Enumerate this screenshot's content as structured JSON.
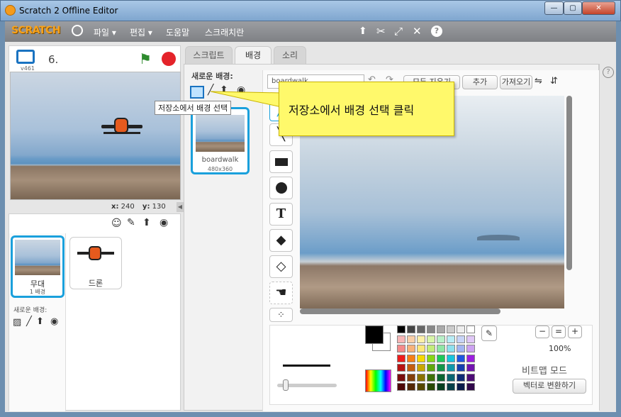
{
  "window": {
    "title": "Scratch 2 Offline Editor",
    "min": "—",
    "max": "▢",
    "close": "✕"
  },
  "menu": {
    "logo": "SCRATCH",
    "file": "파일 ▾",
    "edit": "편집 ▾",
    "help": "도움말",
    "tutorial": "스크래치란"
  },
  "stage": {
    "version": "v461",
    "number": "6.",
    "x_label": "x:",
    "x_value": "240",
    "y_label": "y:",
    "y_value": "130"
  },
  "tabs": [
    "스크립트",
    "배경",
    "소리"
  ],
  "new_backdrop_label": "새로운 배경:",
  "tooltip": "저장소에서 배경 선택",
  "callout": "저장소에서 배경 선택 클릭",
  "backdrop": {
    "name": "boardwalk",
    "size": "480x360",
    "name_field": "boardwalk"
  },
  "buttons": {
    "clear": "모두 지우기",
    "add": "추가",
    "import": "가져오기"
  },
  "sprites": {
    "stage_label": "무대",
    "stage_count": "1 배경",
    "drone": "드론",
    "new_backdrop": "새로운 배경:"
  },
  "zoom": "100%",
  "mode": "비트맵 모드",
  "convert": "벡터로 변환하기",
  "help": "?",
  "colors": {
    "accent": "#1aa0dc",
    "callout": "#fff96b",
    "green_flag": "#2e8b2e",
    "stop": "#e4232a"
  }
}
